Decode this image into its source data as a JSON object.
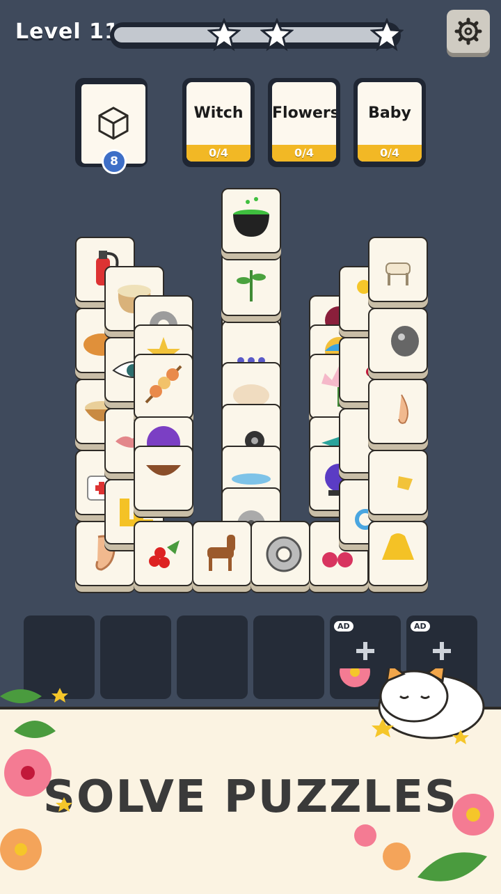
{
  "header": {
    "level_label": "Level 11",
    "stars_earned": 3
  },
  "goals": [
    {
      "label": "Witch",
      "progress": "0/4"
    },
    {
      "label": "Flowers",
      "progress": "0/4"
    },
    {
      "label": "Baby",
      "progress": "0/4"
    }
  ],
  "deck": {
    "count": "8"
  },
  "slots": {
    "ad_label": "AD"
  },
  "banner": {
    "text": "SOLVE PUZZLES"
  },
  "colors": {
    "background": "#3f4a5c",
    "goal_bar": "#f2b825",
    "tile": "#fbf6ea"
  }
}
